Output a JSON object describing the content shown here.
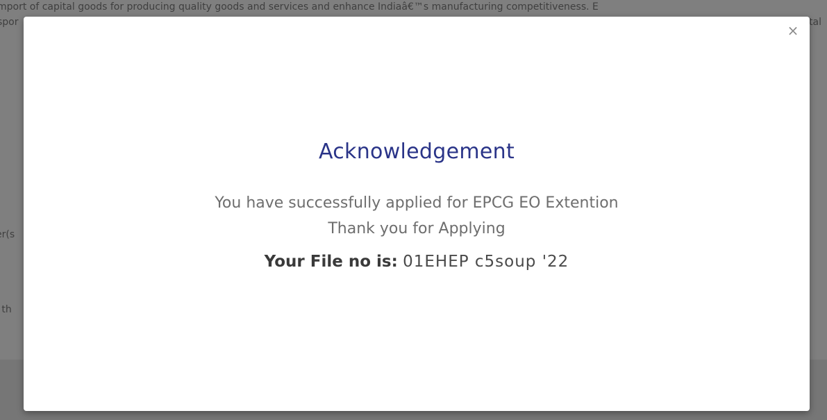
{
  "background": {
    "line1": "mport of capital goods for producing quality goods and services and enhance Indiaâ€™s manufacturing competitiveness. E",
    "line2_left": "spor",
    "line2_right": "tal",
    "line3": "er(s",
    "line4": "l th"
  },
  "modal": {
    "close_symbol": "×",
    "title": "Acknowledgement",
    "message_line1": "You have successfully applied for EPCG EO Extention",
    "message_line2": "Thank you for Applying",
    "file_label": "Your File no is:",
    "file_number": "01EHEP c5soup    '22"
  },
  "colors": {
    "title": "#2a3488",
    "overlay": "#7f7f7f",
    "modal_bg": "#ffffff"
  }
}
